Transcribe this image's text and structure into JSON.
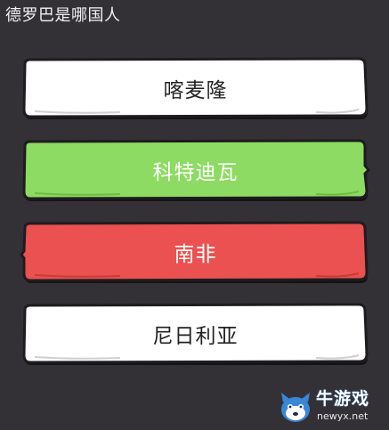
{
  "question": {
    "text": "德罗巴是哪国人"
  },
  "answers": [
    {
      "label": "喀麦隆",
      "state": "default",
      "fill": "#ffffff",
      "text_color": "#222222"
    },
    {
      "label": "科特迪瓦",
      "state": "correct",
      "fill": "#8ddb62",
      "text_color": "#ffffff"
    },
    {
      "label": "南非",
      "state": "wrong",
      "fill": "#ea5150",
      "text_color": "#ffffff"
    },
    {
      "label": "尼日利亚",
      "state": "default",
      "fill": "#ffffff",
      "text_color": "#222222"
    }
  ],
  "watermark": {
    "brand": "牛游戏",
    "url": "newyx.net",
    "icon": "mascot-icon"
  },
  "colors": {
    "background": "#343136",
    "outline": "#1e1c1f",
    "shadow": "#141314",
    "brand_blue": "#3a87d8"
  }
}
